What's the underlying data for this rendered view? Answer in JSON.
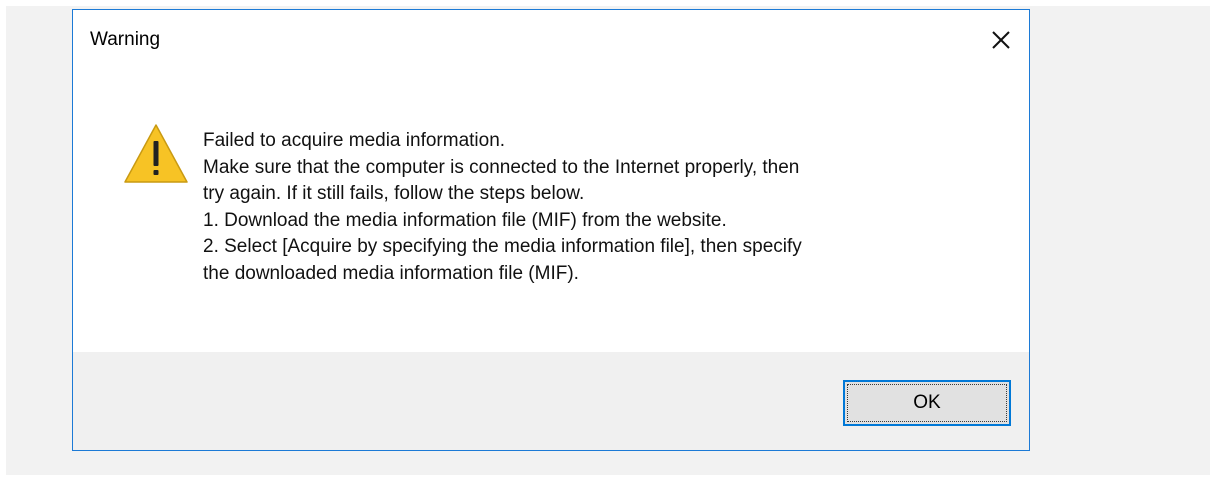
{
  "dialog": {
    "title": "Warning",
    "close_icon": "close-icon",
    "icon": "warning-icon",
    "accent_color": "#0078d7",
    "message_lines": [
      "Failed to acquire media information.",
      "Make sure that the computer is connected to the Internet properly, then",
      "try again. If it still fails, follow the steps below.",
      "1. Download the media information file (MIF) from the website.",
      "2. Select [Acquire by specifying the media information file], then specify",
      "the downloaded media information file (MIF)."
    ],
    "ok_label": "OK"
  }
}
